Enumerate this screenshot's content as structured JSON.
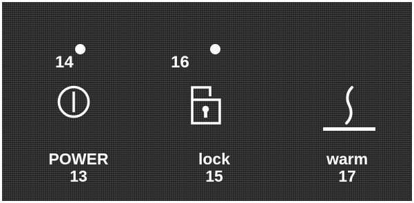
{
  "panel": {
    "background_color": "#2b2b2b",
    "foreground_color": "#ffffff"
  },
  "power": {
    "label": "POWER",
    "ref": "13",
    "indicator_ref": "14",
    "icon": "power-icon"
  },
  "lock": {
    "label": "lock",
    "ref": "15",
    "indicator_ref": "16",
    "icon": "padlock-icon"
  },
  "warm": {
    "label": "warm",
    "ref": "17",
    "icon": "warm-steam-icon"
  }
}
